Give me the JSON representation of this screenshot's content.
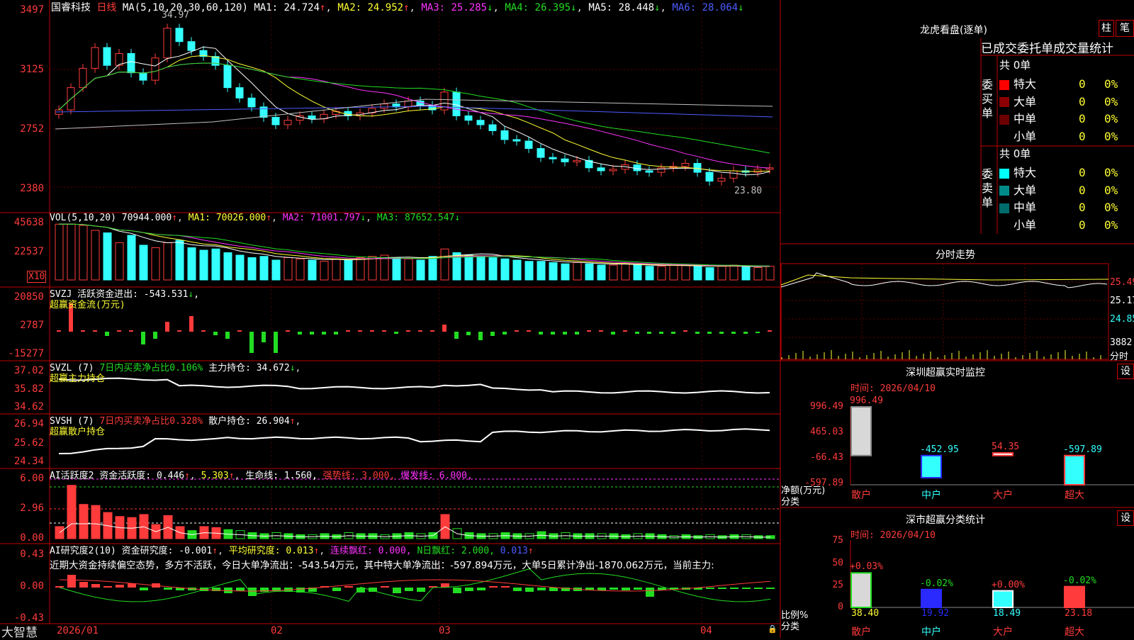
{
  "stock": {
    "name": "国睿科技",
    "period": "日线"
  },
  "main": {
    "ma_params": "MA(5,10,20,30,60,120)",
    "ma1": "MA1: 24.724",
    "ma2": "MA2: 24.952",
    "ma3": "MA3: 25.285",
    "ma4": "MA4: 26.395",
    "ma5": "MA5: 28.448",
    "ma6": "MA6: 28.064",
    "high_mark": "34.97",
    "low_mark": "23.80",
    "y_ticks": [
      "3497",
      "3125",
      "2752",
      "2380"
    ]
  },
  "vol": {
    "params": "VOL(5,10,20)",
    "value": "70944.000",
    "ma1": "MA1: 70026.000",
    "ma2": "MA2: 71001.797",
    "ma3": "MA3: 87652.547",
    "y_ticks": [
      "45638",
      "22537"
    ],
    "unit": "X10"
  },
  "svzj": {
    "label": "SVZJ  活跃资金进出: -543.531",
    "sub": "超赢资金流(万元)",
    "y_ticks": [
      "20850",
      "2787",
      "-15277"
    ]
  },
  "svzl": {
    "label_a": "SVZL (7)",
    "label_b": "7日内买卖净占比0.106%",
    "label_c": "主力持仓: 34.672",
    "sub": "超赢主力持仓",
    "y_ticks": [
      "37.02",
      "35.82",
      "34.62"
    ]
  },
  "svsh": {
    "label_a": "SVSH (7)",
    "label_b": "7日内买卖净占比0.328%",
    "label_c": "散户持仓: 26.904",
    "sub": "超赢散户持仓",
    "y_ticks": [
      "26.94",
      "25.62",
      "24.34"
    ]
  },
  "ai1": {
    "label_a": "AI活跃度2 资金活跃度: 0.446",
    "label_b": "5.303",
    "label_c": "生命线: 1.560,",
    "label_d": "强势线: 3.000,",
    "label_e": "爆发线: 6.000,",
    "y_ticks": [
      "6.00",
      "2.96",
      "0.00"
    ]
  },
  "ai2": {
    "label_a": "AI研究度2(10) 资金研究度: -0.001",
    "label_b": "平均研究度: 0.013",
    "label_c": "连续飘红: 0.000,",
    "label_d": "N日飘红: 2.000,",
    "label_e": "0.013",
    "comment": "近期大资金持续偏空态势，多方不活跃，今日大单净流出：-543.54万元，其中特大单净流出：-597.894万元，大单5日累计净出-1870.062万元，当前主力: ",
    "y_ticks": [
      "0.43",
      "0.00",
      "-0.43"
    ]
  },
  "xaxis": {
    "labels": [
      "2026/01",
      "02",
      "03",
      "04"
    ]
  },
  "brand": "大智慧",
  "dragon": {
    "title": "龙虎看盘(逐单)",
    "btn_bar": "柱",
    "btn_pen": "笔",
    "subtitle": "已成交委托单成交量统计",
    "buy": {
      "side": "委买单",
      "total": "共 0单",
      "rows": [
        {
          "name": "特大",
          "count": "0",
          "pct": "0%",
          "color": "#ff0000"
        },
        {
          "name": "大单",
          "count": "0",
          "pct": "0%",
          "color": "#8b0000"
        },
        {
          "name": "中单",
          "count": "0",
          "pct": "0%",
          "color": "#6b0000"
        },
        {
          "name": "小单",
          "count": "0",
          "pct": "0%",
          "color": "#000000"
        }
      ]
    },
    "sell": {
      "side": "委卖单",
      "total": "共 0单",
      "rows": [
        {
          "name": "特大",
          "count": "0",
          "pct": "0%",
          "color": "#00ffff"
        },
        {
          "name": "大单",
          "count": "0",
          "pct": "0%",
          "color": "#008b8b"
        },
        {
          "name": "中单",
          "count": "0",
          "pct": "0%",
          "color": "#006b6b"
        },
        {
          "name": "小单",
          "count": "0",
          "pct": "0%",
          "color": "#000000"
        }
      ]
    }
  },
  "intraday": {
    "title": "分时走势",
    "y_ticks": [
      "25.49",
      "25.17",
      "24.85"
    ],
    "vol_tick": "3882",
    "vol_label": "分时"
  },
  "monitor": {
    "title": "深圳超赢实时监控",
    "btn": "设",
    "time": "时间: 2026/04/10",
    "y_ticks": [
      "996.49",
      "465.03",
      "-66.43",
      "-597.89"
    ],
    "ylabel": "净额(万元)",
    "xlabel": "分类",
    "chart_data": {
      "type": "bar",
      "categories": [
        "散户",
        "中户",
        "大户",
        "超大"
      ],
      "values": [
        996.49,
        -452.95,
        54.35,
        -597.89
      ],
      "ylim": [
        -597.89,
        996.49
      ],
      "value_labels": [
        "996.49",
        "-452.95",
        "54.35",
        "-597.89"
      ]
    }
  },
  "classify": {
    "title": "深市超赢分类统计",
    "btn": "设",
    "time": "时间: 2026/04/10",
    "y_ticks": [
      "75",
      "50",
      "25",
      "0"
    ],
    "ylabel": "比例%",
    "xlabel": "分类",
    "chart_data": {
      "type": "bar",
      "categories": [
        "散户",
        "中户",
        "大户",
        "超大"
      ],
      "values": [
        38.4,
        19.92,
        18.49,
        23.18
      ],
      "ylim": [
        0,
        75
      ],
      "value_labels": [
        "38.40",
        "19.92",
        "18.49",
        "23.18"
      ],
      "change_labels": [
        "+0.03%",
        "-0.02%",
        "+0.00%",
        "-0.02%"
      ]
    }
  },
  "colors": {
    "up": "#ff3b3b",
    "down": "#33ffff",
    "grid": "#c00000"
  }
}
